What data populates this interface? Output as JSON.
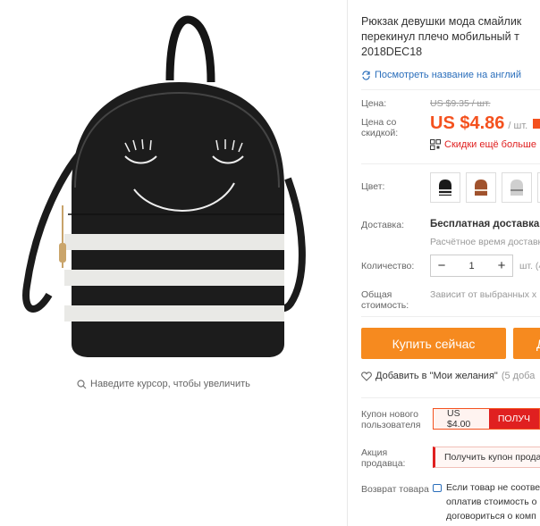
{
  "product": {
    "title_line1": "Рюкзак девушки мода смайлик",
    "title_line2": "перекинул плечо мобильный т",
    "title_line3": "2018DEC18",
    "translate_link": "Посмотреть название на англий"
  },
  "image": {
    "zoom_hint": "Наведите курсор, чтобы увеличить"
  },
  "price": {
    "label": "Цена:",
    "old": "US $9.35 / шт.",
    "discount_label": "Цена со скидкой:",
    "new": "US $4.86",
    "unit": "/ шт.",
    "app_promo": "Скидки ещё больше"
  },
  "color": {
    "label": "Цвет:",
    "swatch_colors": [
      "#1a1a1a",
      "#a0522d",
      "#cfcfcf",
      "#f2f2f2"
    ]
  },
  "shipping": {
    "label": "Доставка:",
    "value": "Бесплатная доставка в",
    "time": "Расчётное время доставк"
  },
  "quantity": {
    "label": "Количество:",
    "value": "1",
    "minus": "−",
    "plus": "+",
    "unit": "шт. (4"
  },
  "total": {
    "label": "Общая стоимость:",
    "value": "Зависит от выбранных х"
  },
  "actions": {
    "buy_now": "Купить сейчас",
    "add_to_cart": "Д",
    "wishlist": "Добавить в \"Мои желания\"",
    "wishlist_count": "(5 доба"
  },
  "coupons": {
    "new_user_label": "Купон нового пользователя",
    "new_user_amount": "US $4.00",
    "new_user_button": "ПОЛУЧ",
    "seller_label": "Акция продавца:",
    "seller_text": "Получить купон прода"
  },
  "returns": {
    "label": "Возврат товара",
    "line1": "Если товар не соотве",
    "line2": "оплатив стоимость о",
    "line3": "договориться о комп"
  },
  "colors": {
    "accent": "#f4511e",
    "button": "#f68a1f",
    "link": "#2a6ebb"
  }
}
